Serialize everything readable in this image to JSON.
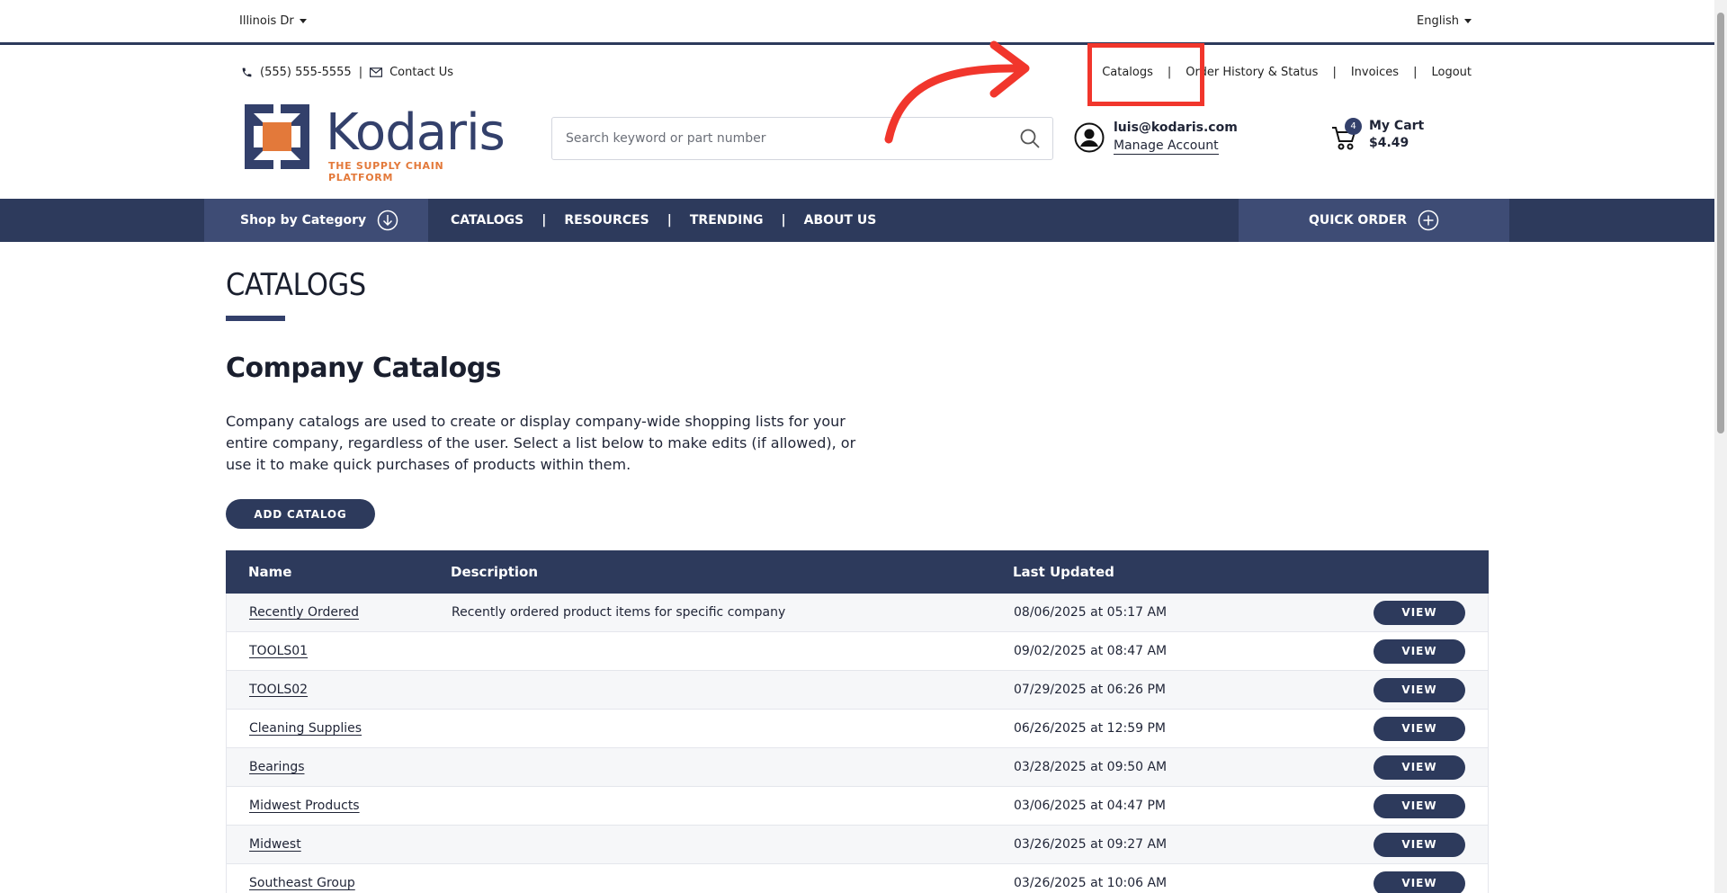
{
  "topbar": {
    "location": "Illinois Dr",
    "language": "English"
  },
  "header": {
    "phone": "(555) 555-5555",
    "contact": "Contact Us",
    "utility_links": [
      "Catalogs",
      "Order History & Status",
      "Invoices",
      "Logout"
    ],
    "logo_word": "Kodaris",
    "logo_tagline": "THE SUPPLY CHAIN PLATFORM",
    "search_placeholder": "Search keyword or part number",
    "account_email": "luis@kodaris.com",
    "account_manage": "Manage Account",
    "cart_label": "My Cart",
    "cart_total": "$4.49",
    "cart_count": "4"
  },
  "nav": {
    "shop_by_category": "Shop by Category",
    "links": [
      "CATALOGS",
      "RESOURCES",
      "TRENDING",
      "ABOUT US"
    ],
    "quick_order": "QUICK ORDER"
  },
  "main": {
    "page_title": "CATALOGS",
    "section_title": "Company Catalogs",
    "intro": "Company catalogs are used to create or display company-wide shopping lists for your entire company, regardless of the user. Select a list below to make edits (if allowed), or use it to make quick purchases of products within them.",
    "add_button": "ADD CATALOG",
    "table": {
      "headers": [
        "Name",
        "Description",
        "Last Updated"
      ],
      "view_label": "VIEW",
      "rows": [
        {
          "name": "Recently Ordered",
          "description": "Recently ordered product items for specific company",
          "updated": "08/06/2025 at 05:17 AM"
        },
        {
          "name": "TOOLS01",
          "description": "",
          "updated": "09/02/2025 at 08:47 AM"
        },
        {
          "name": "TOOLS02",
          "description": "",
          "updated": "07/29/2025 at 06:26 PM"
        },
        {
          "name": "Cleaning Supplies",
          "description": "",
          "updated": "06/26/2025 at 12:59 PM"
        },
        {
          "name": "Bearings",
          "description": "",
          "updated": "03/28/2025 at 09:50 AM"
        },
        {
          "name": "Midwest Products",
          "description": "",
          "updated": "03/06/2025 at 04:47 PM"
        },
        {
          "name": "Midwest",
          "description": "",
          "updated": "03/26/2025 at 09:27 AM"
        },
        {
          "name": "Southeast Group",
          "description": "",
          "updated": "03/26/2025 at 10:06 AM"
        }
      ]
    }
  },
  "colors": {
    "navy": "#2d3a5c",
    "accent_orange": "#e3793a",
    "annotation_red": "#f1362c"
  }
}
